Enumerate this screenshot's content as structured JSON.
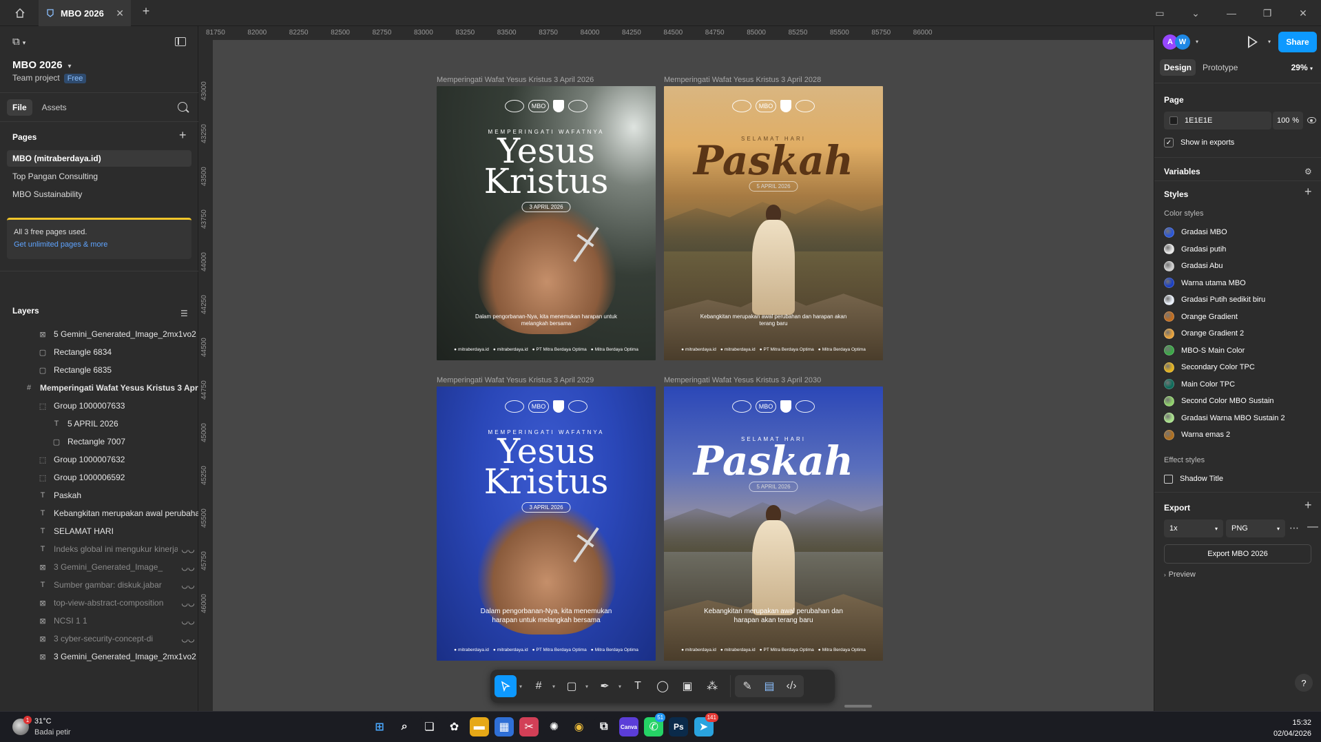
{
  "titlebar": {
    "tab_title": "MBO 2026"
  },
  "left": {
    "project_name": "MBO 2026",
    "project_team": "Team project",
    "project_badge": "Free",
    "tabs": [
      "File",
      "Assets"
    ],
    "pages_title": "Pages",
    "pages": [
      "MBO (mitraberdaya.id)",
      "Top Pangan Consulting",
      "MBO Sustainability"
    ],
    "free_notice": "All 3 free pages used.",
    "free_link": "Get unlimited pages & more",
    "layers_title": "Layers",
    "layers": [
      {
        "label": "5 Gemini_Generated_Image_2mx1vo2",
        "icon": "image-icon",
        "indent": 56,
        "dim": false,
        "eye": false,
        "bold": false
      },
      {
        "label": "Rectangle 6834",
        "icon": "rect-icon",
        "indent": 56,
        "dim": false,
        "eye": false,
        "bold": false
      },
      {
        "label": "Rectangle 6835",
        "icon": "rect-icon",
        "indent": 56,
        "dim": false,
        "eye": false,
        "bold": false
      },
      {
        "label": "Memperingati Wafat Yesus Kristus 3 April 2026",
        "icon": "frame-icon",
        "indent": 36,
        "dim": false,
        "eye": false,
        "bold": true
      },
      {
        "label": "Group 1000007633",
        "icon": "group-icon",
        "indent": 56,
        "dim": false,
        "eye": false,
        "bold": false
      },
      {
        "label": "5 APRIL 2026",
        "icon": "text-icon",
        "indent": 76,
        "dim": false,
        "eye": false,
        "bold": false
      },
      {
        "label": "Rectangle 7007",
        "icon": "rect-icon",
        "indent": 76,
        "dim": false,
        "eye": false,
        "bold": false
      },
      {
        "label": "Group 1000007632",
        "icon": "group-icon",
        "indent": 56,
        "dim": false,
        "eye": false,
        "bold": false
      },
      {
        "label": "Group 1000006592",
        "icon": "group-icon",
        "indent": 56,
        "dim": false,
        "eye": false,
        "bold": false
      },
      {
        "label": "Paskah",
        "icon": "text-icon",
        "indent": 56,
        "dim": false,
        "eye": false,
        "bold": false
      },
      {
        "label": "Kebangkitan merupakan awal perubahan dan harapan akan terang baru",
        "icon": "text-icon",
        "indent": 56,
        "dim": false,
        "eye": false,
        "bold": false
      },
      {
        "label": "SELAMAT HARI",
        "icon": "text-icon",
        "indent": 56,
        "dim": false,
        "eye": false,
        "bold": false
      },
      {
        "label": "Indeks global ini mengukur kinerja",
        "icon": "text-icon",
        "indent": 56,
        "dim": true,
        "eye": true,
        "bold": false
      },
      {
        "label": "3 Gemini_Generated_Image_",
        "icon": "image-icon",
        "indent": 56,
        "dim": true,
        "eye": true,
        "bold": false
      },
      {
        "label": "Sumber gambar: diskuk.jabar",
        "icon": "text-icon",
        "indent": 56,
        "dim": true,
        "eye": true,
        "bold": false
      },
      {
        "label": "top-view-abstract-composition",
        "icon": "image-icon",
        "indent": 56,
        "dim": true,
        "eye": true,
        "bold": false
      },
      {
        "label": "NCSI 1 1",
        "icon": "image-icon",
        "indent": 56,
        "dim": true,
        "eye": true,
        "bold": false
      },
      {
        "label": "3 cyber-security-concept-di",
        "icon": "image-icon",
        "indent": 56,
        "dim": true,
        "eye": true,
        "bold": false
      },
      {
        "label": "3 Gemini_Generated_Image_2mx1vo2",
        "icon": "image-icon",
        "indent": 56,
        "dim": false,
        "eye": false,
        "bold": false
      }
    ]
  },
  "canvas": {
    "ruler_top": [
      "81750",
      "82000",
      "82250",
      "82500",
      "82750",
      "83000",
      "83250",
      "83500",
      "83750",
      "84000",
      "84250",
      "84500",
      "84750",
      "85000",
      "85250",
      "85500",
      "85750",
      "86000"
    ],
    "ruler_left": [
      "43000",
      "43250",
      "43500",
      "43750",
      "44000",
      "44250",
      "44500",
      "44750",
      "45000",
      "45250",
      "45500",
      "45750",
      "46000"
    ],
    "frames": [
      {
        "label": "Memperingati Wafat Yesus Kristus 3 April 2026",
        "style": "dark",
        "kind": "yesus",
        "logo_text": "MBO",
        "sub": "MEMPERINGATI WAFATNYA",
        "title1": "Yesus",
        "title2": "Kristus",
        "date": "3 APRIL 2026",
        "desc": "Dalam pengorbanan-Nya, kita menemukan harapan untuk melangkah bersama",
        "footer": [
          "mitraberdaya.id",
          "mitraberdaya.id",
          "PT Mitra Berdaya Optima",
          "Mitra Berdaya Optima"
        ]
      },
      {
        "label": "Memperingati Wafat Yesus Kristus 3 April 2028",
        "style": "sunset",
        "kind": "paskah",
        "logo_text": "MBO",
        "sub": "SELAMAT HARI",
        "title1": "Paskah",
        "date": "5 APRIL 2026",
        "desc": "Kebangkitan merupakan awal perubahan dan harapan akan terang baru",
        "footer": [
          "mitraberdaya.id",
          "mitraberdaya.id",
          "PT Mitra Berdaya Optima",
          "Mitra Berdaya Optima"
        ]
      },
      {
        "label": "Memperingati Wafat Yesus Kristus 3 April 2029",
        "style": "blue",
        "kind": "yesus",
        "logo_text": "MBO",
        "sub": "MEMPERINGATI WAFATNYA",
        "title1": "Yesus",
        "title2": "Kristus",
        "date": "3 APRIL 2026",
        "desc": "Dalam pengorbanan-Nya, kita menemukan harapan untuk melangkah bersama",
        "footer": [
          "mitraberdaya.id",
          "mitraberdaya.id",
          "PT Mitra Berdaya Optima",
          "Mitra Berdaya Optima"
        ]
      },
      {
        "label": "Memperingati Wafat Yesus Kristus 3 April 2030",
        "style": "blue-scenic",
        "kind": "paskah",
        "logo_text": "MBO",
        "sub": "SELAMAT HARI",
        "title1": "Paskah",
        "date": "5 APRIL 2026",
        "desc": "Kebangkitan merupakan awal perubahan dan harapan akan terang baru",
        "footer": [
          "mitraberdaya.id",
          "mitraberdaya.id",
          "PT Mitra Berdaya Optima",
          "Mitra Berdaya Optima"
        ]
      }
    ]
  },
  "toolbar": {
    "tools": [
      "move-tool",
      "frame-tool",
      "shape-tool",
      "pen-tool",
      "text-tool",
      "comment-tool",
      "slot-tool",
      "components-tool"
    ],
    "group_tools": [
      "draw-mode",
      "design-mode",
      "dev-mode"
    ]
  },
  "right": {
    "avatars": [
      {
        "initial": "A",
        "color": "#9747ff"
      },
      {
        "initial": "W",
        "color": "#1e88e5"
      }
    ],
    "share_label": "Share",
    "tabs": [
      "Design",
      "Prototype"
    ],
    "zoom": "29%",
    "page_title": "Page",
    "page_fill": "1E1E1E",
    "page_opacity": "100",
    "page_opacity_unit": "%",
    "show_in_exports": "Show in exports",
    "variables_title": "Variables",
    "styles_title": "Styles",
    "color_styles_title": "Color styles",
    "color_styles": [
      {
        "name": "Gradasi MBO",
        "color": "#2a56d8"
      },
      {
        "name": "Gradasi putih",
        "color": "#e6e6e6"
      },
      {
        "name": "Gradasi Abu",
        "color": "#cfcfcf"
      },
      {
        "name": "Warna utama MBO",
        "color": "#1a3fc4"
      },
      {
        "name": "Gradasi Putih sedikit biru",
        "color": "#e8eef8"
      },
      {
        "name": "Orange Gradient",
        "color": "#c26d1e"
      },
      {
        "name": "Orange Gradient 2",
        "color": "#e8a23a"
      },
      {
        "name": "MBO-S Main Color",
        "color": "#3aa846"
      },
      {
        "name": "Secondary Color TPC",
        "color": "#e3b21e"
      },
      {
        "name": "Main Color TPC",
        "color": "#0d6b5a"
      },
      {
        "name": "Second Color MBO Sustain",
        "color": "#8fd06a"
      },
      {
        "name": "Gradasi Warna MBO Sustain 2",
        "color": "#a8e08a"
      },
      {
        "name": "Warna emas 2",
        "color": "#b0701f"
      }
    ],
    "effect_styles_title": "Effect styles",
    "effect_styles": [
      "Shadow Title"
    ],
    "export_title": "Export",
    "export_scale": "1x",
    "export_format": "PNG",
    "export_button": "Export MBO 2026",
    "preview_label": "Preview",
    "help": "?"
  },
  "taskbar": {
    "weather_temp": "31°C",
    "weather_desc": "Badai petir",
    "weather_badge": "1",
    "apps": [
      {
        "name": "windows-start",
        "label": "",
        "color": "#1b1c22"
      },
      {
        "name": "search",
        "label": "",
        "color": "#1b1c22"
      },
      {
        "name": "task-view",
        "label": "",
        "color": "#1b1c22"
      },
      {
        "name": "copilot",
        "label": "",
        "color": "#1b1c22"
      },
      {
        "name": "file-explorer",
        "label": "",
        "color": "#e6a817"
      },
      {
        "name": "microsoft-store",
        "label": "",
        "color": "#2f6fd6"
      },
      {
        "name": "snipping-tool",
        "label": "",
        "color": "#d23f57"
      },
      {
        "name": "chatgpt",
        "label": "",
        "color": "#1b1c22"
      },
      {
        "name": "chrome",
        "label": "",
        "color": "#1b1c22"
      },
      {
        "name": "figma",
        "label": "",
        "color": "#1b1c22"
      },
      {
        "name": "canva",
        "label": "Canva",
        "color": "#5b3dd8"
      },
      {
        "name": "whatsapp",
        "label": "",
        "color": "#25d366"
      },
      {
        "name": "photoshop",
        "label": "Ps",
        "color": "#0a2a4a"
      },
      {
        "name": "telegram",
        "label": "",
        "color": "#2aa3df"
      }
    ],
    "whatsapp_badge": "51",
    "telegram_badge": "141",
    "time": "15:32",
    "date": "02/04/2026"
  }
}
